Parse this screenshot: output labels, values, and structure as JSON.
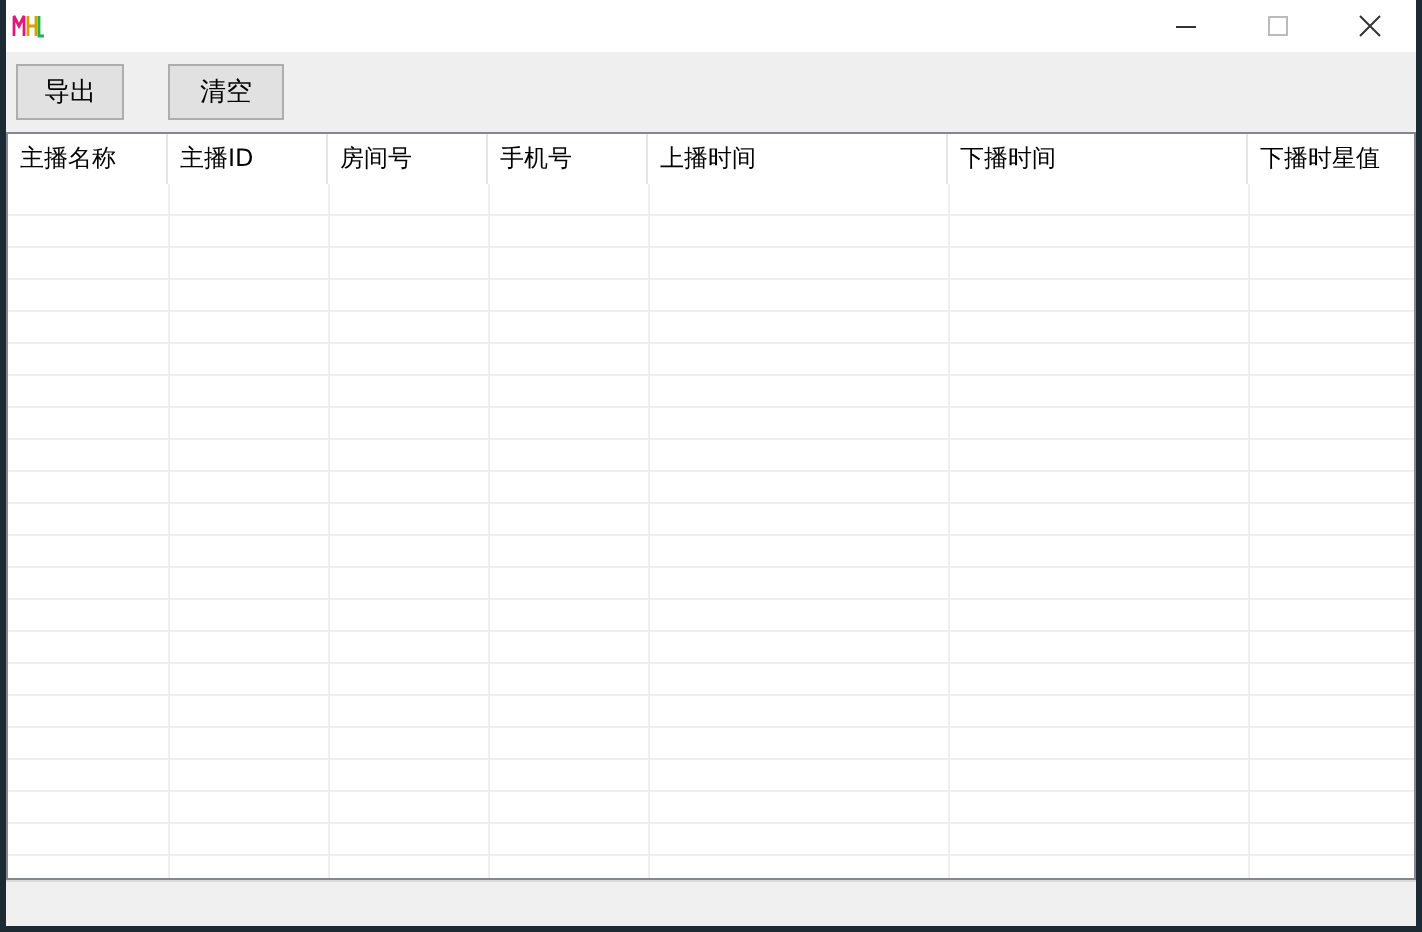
{
  "toolbar": {
    "buttons": [
      "导出",
      "清空"
    ]
  },
  "table": {
    "columns": [
      "主播名称",
      "主播ID",
      "房间号",
      "手机号",
      "上播时间",
      "下播时间",
      "下播时星值"
    ]
  }
}
